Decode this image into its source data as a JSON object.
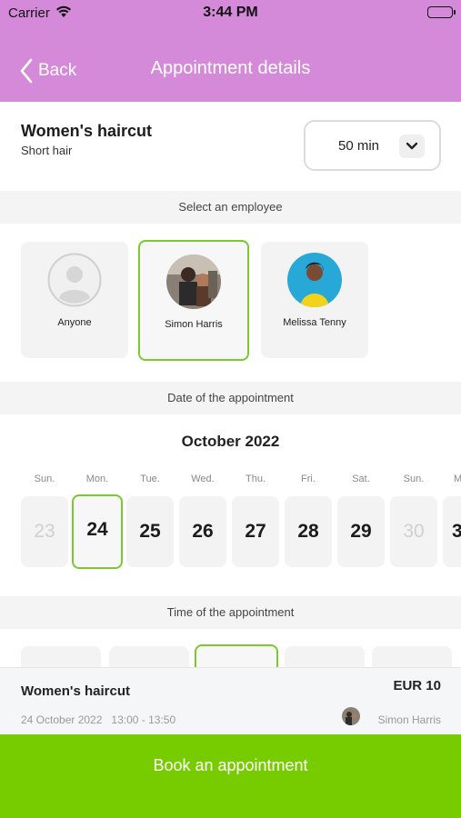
{
  "status_bar": {
    "carrier": "Carrier",
    "time": "3:44 PM"
  },
  "nav": {
    "back_label": "Back",
    "title": "Appointment details"
  },
  "service": {
    "name": "Women's haircut",
    "variant": "Short hair",
    "duration": "50 min"
  },
  "sections": {
    "employee": "Select an employee",
    "date": "Date of the appointment",
    "time": "Time of the appointment"
  },
  "employees": [
    {
      "name": "Anyone",
      "selected": false
    },
    {
      "name": "Simon Harris",
      "selected": true
    },
    {
      "name": "Melissa Tenny",
      "selected": false
    }
  ],
  "calendar": {
    "month": "October 2022",
    "days": [
      {
        "dow": "Sun.",
        "num": "23",
        "disabled": true
      },
      {
        "dow": "Mon.",
        "num": "24",
        "selected": true
      },
      {
        "dow": "Tue.",
        "num": "25"
      },
      {
        "dow": "Wed.",
        "num": "26"
      },
      {
        "dow": "Thu.",
        "num": "27"
      },
      {
        "dow": "Fri.",
        "num": "28"
      },
      {
        "dow": "Sat.",
        "num": "29"
      },
      {
        "dow": "Sun.",
        "num": "30",
        "disabled": true
      },
      {
        "dow": "M",
        "num": "3"
      }
    ]
  },
  "summary": {
    "service": "Women's haircut",
    "price": "EUR 10",
    "date_time": "24 October 2022   13:00 - 13:50",
    "employee": "Simon Harris"
  },
  "book_button": "Book an appointment",
  "colors": {
    "header": "#d48ad8",
    "accent_green": "#77cc00",
    "selected_border": "#7cc832"
  }
}
